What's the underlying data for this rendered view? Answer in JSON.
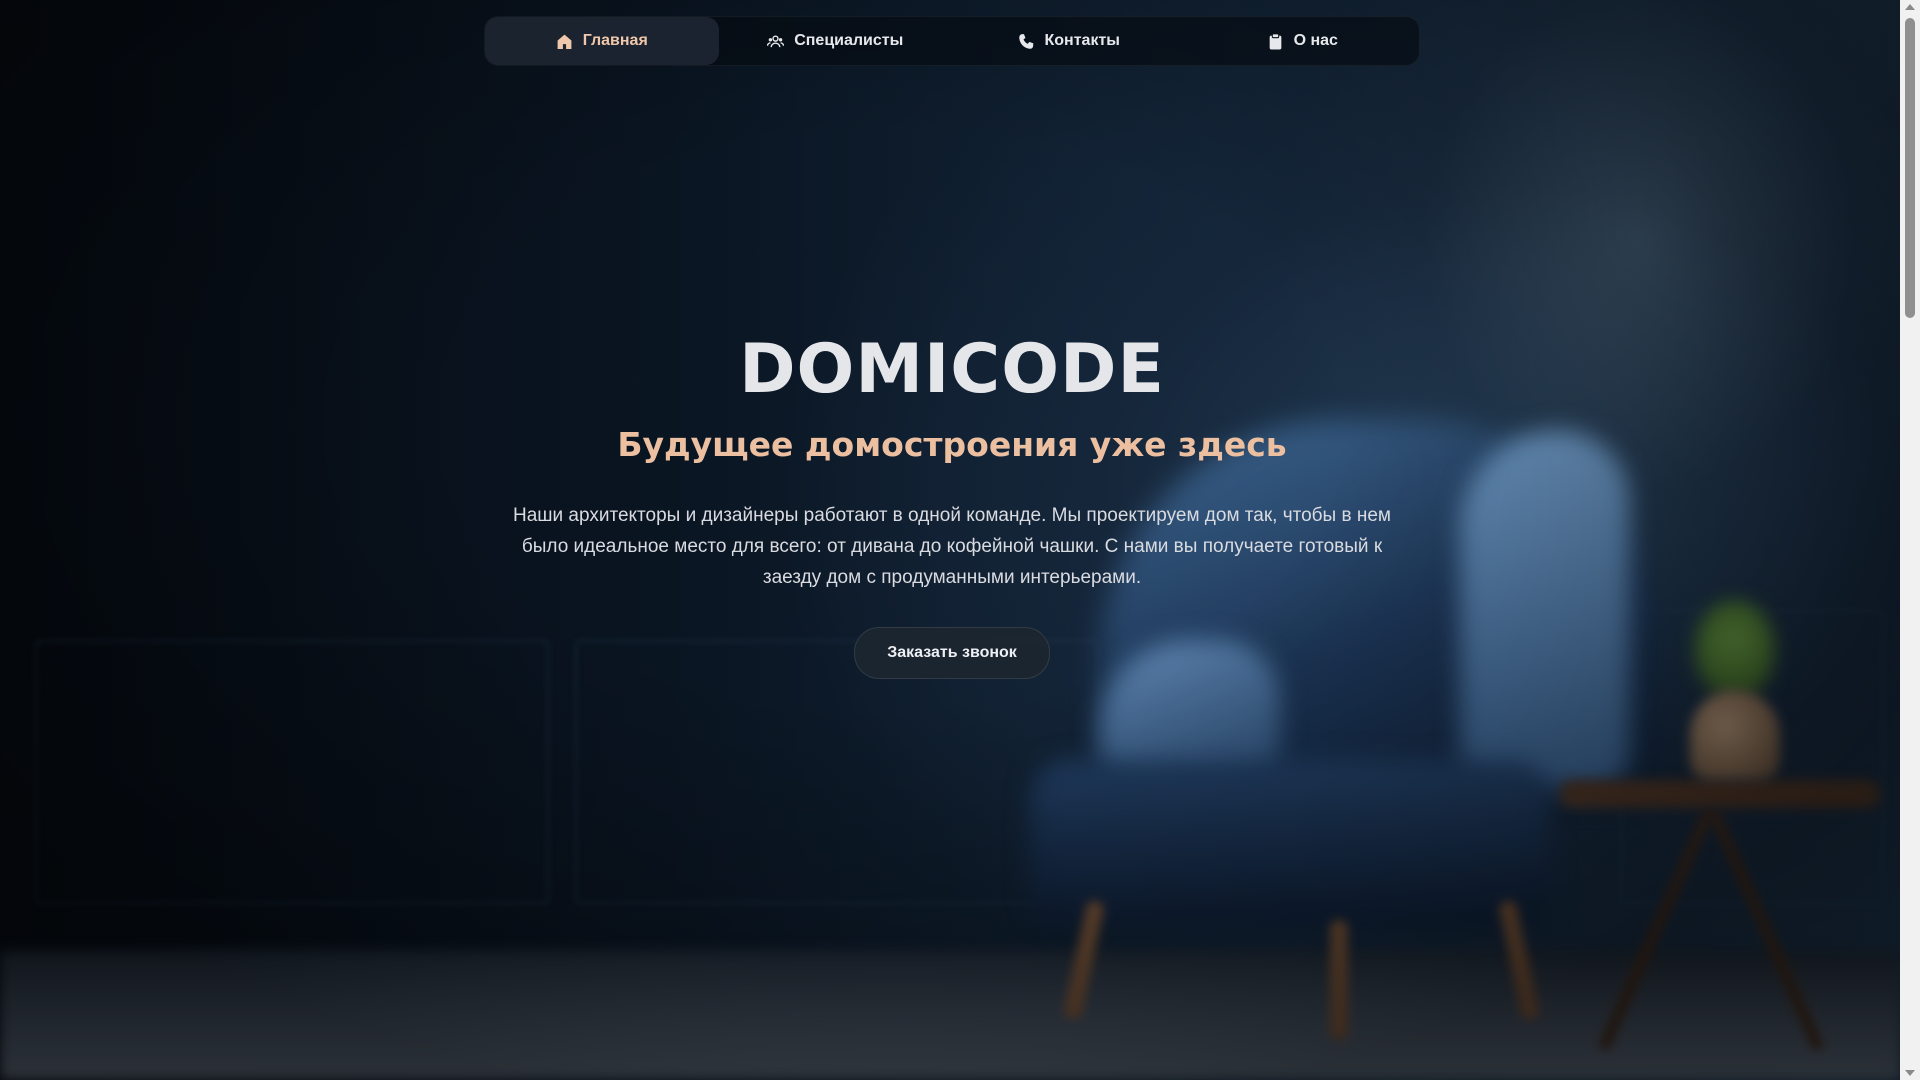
{
  "nav": {
    "items": [
      {
        "label": "Главная",
        "icon": "home-icon",
        "active": true
      },
      {
        "label": "Специалисты",
        "icon": "users-icon",
        "active": false
      },
      {
        "label": "Контакты",
        "icon": "phone-icon",
        "active": false
      },
      {
        "label": "О нас",
        "icon": "clipboard-icon",
        "active": false
      }
    ]
  },
  "hero": {
    "brand": "DOMICODE",
    "tagline": "Будущее домостроения уже здесь",
    "description": "Наши архитекторы и дизайнеры работают в одной команде. Мы проектируем дом так, чтобы в нем было идеальное место для всего: от дивана до кофейной чашки. С нами вы получаете готовый к заезду дом с продуманными интерьерами.",
    "cta_label": "Заказать звонок"
  },
  "colors": {
    "accent": "#ebbf9f",
    "nav_active_text": "#f0c7aa",
    "background": "#0b1420"
  }
}
